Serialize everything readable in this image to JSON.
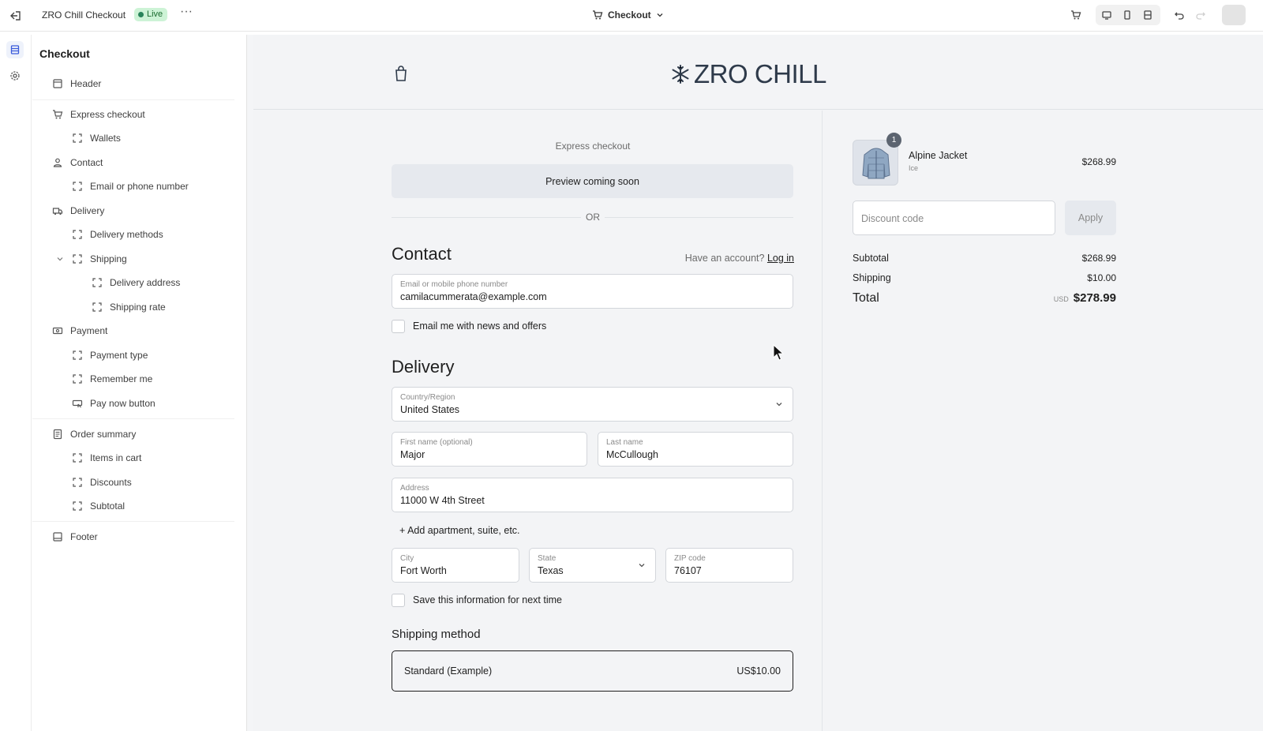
{
  "topbar": {
    "app_title": "ZRO Chill Checkout",
    "status_badge": "Live",
    "more_label": "···",
    "page_selector": "Checkout"
  },
  "sidebar": {
    "title": "Checkout",
    "items": [
      {
        "label": "Header",
        "icon": "header-section-icon"
      },
      {
        "label": "Express checkout",
        "icon": "cart-icon"
      },
      {
        "label": "Wallets",
        "icon": "block-icon"
      },
      {
        "label": "Contact",
        "icon": "person-icon"
      },
      {
        "label": "Email or phone number",
        "icon": "block-icon"
      },
      {
        "label": "Delivery",
        "icon": "truck-icon"
      },
      {
        "label": "Delivery methods",
        "icon": "block-icon"
      },
      {
        "label": "Shipping",
        "icon": "block-icon"
      },
      {
        "label": "Delivery address",
        "icon": "block-icon"
      },
      {
        "label": "Shipping rate",
        "icon": "block-icon"
      },
      {
        "label": "Payment",
        "icon": "money-icon"
      },
      {
        "label": "Payment type",
        "icon": "block-icon"
      },
      {
        "label": "Remember me",
        "icon": "block-icon"
      },
      {
        "label": "Pay now button",
        "icon": "button-icon"
      },
      {
        "label": "Order summary",
        "icon": "receipt-icon"
      },
      {
        "label": "Items in cart",
        "icon": "block-icon"
      },
      {
        "label": "Discounts",
        "icon": "block-icon"
      },
      {
        "label": "Subtotal",
        "icon": "block-icon"
      },
      {
        "label": "Footer",
        "icon": "footer-section-icon"
      }
    ]
  },
  "store": {
    "logo_text": "ZRO CHILL",
    "express_label": "Express checkout",
    "express_preview": "Preview coming soon",
    "or_text": "OR",
    "contact": {
      "heading": "Contact",
      "account_prompt": "Have an account?",
      "login_link": "Log in",
      "email_label": "Email or mobile phone number",
      "email_value": "camilacummerata@example.com",
      "newsletter_label": "Email me with news and offers"
    },
    "delivery": {
      "heading": "Delivery",
      "country_label": "Country/Region",
      "country_value": "United States",
      "first_name_label": "First name (optional)",
      "first_name_value": "Major",
      "last_name_label": "Last name",
      "last_name_value": "McCullough",
      "address_label": "Address",
      "address_value": "11000 W 4th Street",
      "add_apartment": "+ Add apartment, suite, etc.",
      "city_label": "City",
      "city_value": "Fort Worth",
      "state_label": "State",
      "state_value": "Texas",
      "zip_label": "ZIP code",
      "zip_value": "76107",
      "save_info_label": "Save this information for next time"
    },
    "shipping_method": {
      "heading": "Shipping method",
      "option_name": "Standard (Example)",
      "option_price": "US$10.00"
    },
    "summary": {
      "item_qty": "1",
      "item_name": "Alpine Jacket",
      "item_variant": "Ice",
      "item_price": "$268.99",
      "discount_placeholder": "Discount code",
      "apply_label": "Apply",
      "subtotal_label": "Subtotal",
      "subtotal_value": "$268.99",
      "shipping_label": "Shipping",
      "shipping_value": "$10.00",
      "total_label": "Total",
      "total_currency": "USD",
      "total_value": "$278.99"
    }
  },
  "colors": {
    "live_badge_bg": "#cdf3d6",
    "live_badge_dot": "#29845a",
    "logo": "#2e3a4a",
    "canvas_bg": "#f3f4f6"
  }
}
